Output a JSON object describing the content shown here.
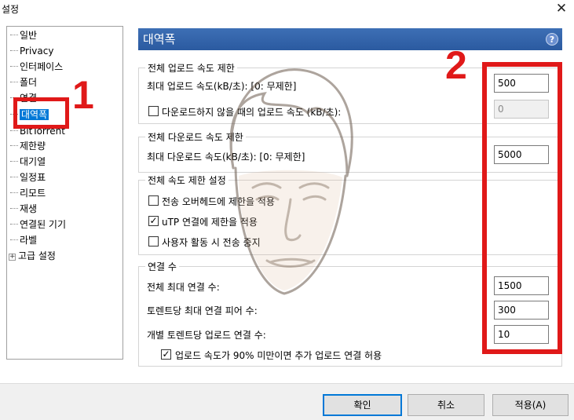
{
  "window": {
    "title": "설정",
    "close_glyph": "✕"
  },
  "tree": {
    "items": [
      {
        "label": "일반"
      },
      {
        "label": "Privacy"
      },
      {
        "label": "인터페이스"
      },
      {
        "label": "폴더"
      },
      {
        "label": "연결"
      },
      {
        "label": "대역폭"
      },
      {
        "label": "BitTorrent"
      },
      {
        "label": "제한량"
      },
      {
        "label": "대기열"
      },
      {
        "label": "일정표"
      },
      {
        "label": "리모트"
      },
      {
        "label": "재생"
      },
      {
        "label": "연결된 기기"
      },
      {
        "label": "라벨"
      },
      {
        "label": "고급 설정",
        "expand": "+"
      }
    ],
    "selected": "대역폭"
  },
  "annotations": {
    "num1": "1",
    "num2": "2",
    "color": "#e01919"
  },
  "panel": {
    "title": "대역폭",
    "help": "?"
  },
  "upload_limit": {
    "group_title": "전체 업로드 속도 제한",
    "max_label": "최대 업로드 속도(kB/초): [0: 무제한]",
    "max_value": "500",
    "alt_label": "다운로드하지 않을 때의 업로드 속도 (kB/초):",
    "alt_value": "0",
    "alt_checked": false
  },
  "download_limit": {
    "group_title": "전체 다운로드 속도 제한",
    "max_label": "최대 다운로드 속도(kB/초): [0: 무제한]",
    "max_value": "5000"
  },
  "global_limit": {
    "group_title": "전체 속도 제한 설정",
    "opt1_label": "전송 오버헤드에 제한을 적용",
    "opt1_checked": false,
    "opt2_label": "uTP 연결에 제한을 적용",
    "opt2_checked": true,
    "opt3_label": "사용자 활동 시 전송 중지",
    "opt3_checked": false
  },
  "connections": {
    "group_title": "연결 수",
    "max_conn_label": "전체 최대 연결 수:",
    "max_conn_value": "1500",
    "peers_label": "토렌트당 최대 연결 피어 수:",
    "peers_value": "300",
    "upload_slots_label": "개별 토렌트당 업로드 연결 수:",
    "upload_slots_value": "10",
    "extra_label": "업로드 속도가 90% 미만이면 추가 업로드 연결 허용",
    "extra_checked": true
  },
  "check_glyph": "✓",
  "buttons": {
    "ok": "확인",
    "cancel": "취소",
    "apply": "적용(A)"
  }
}
